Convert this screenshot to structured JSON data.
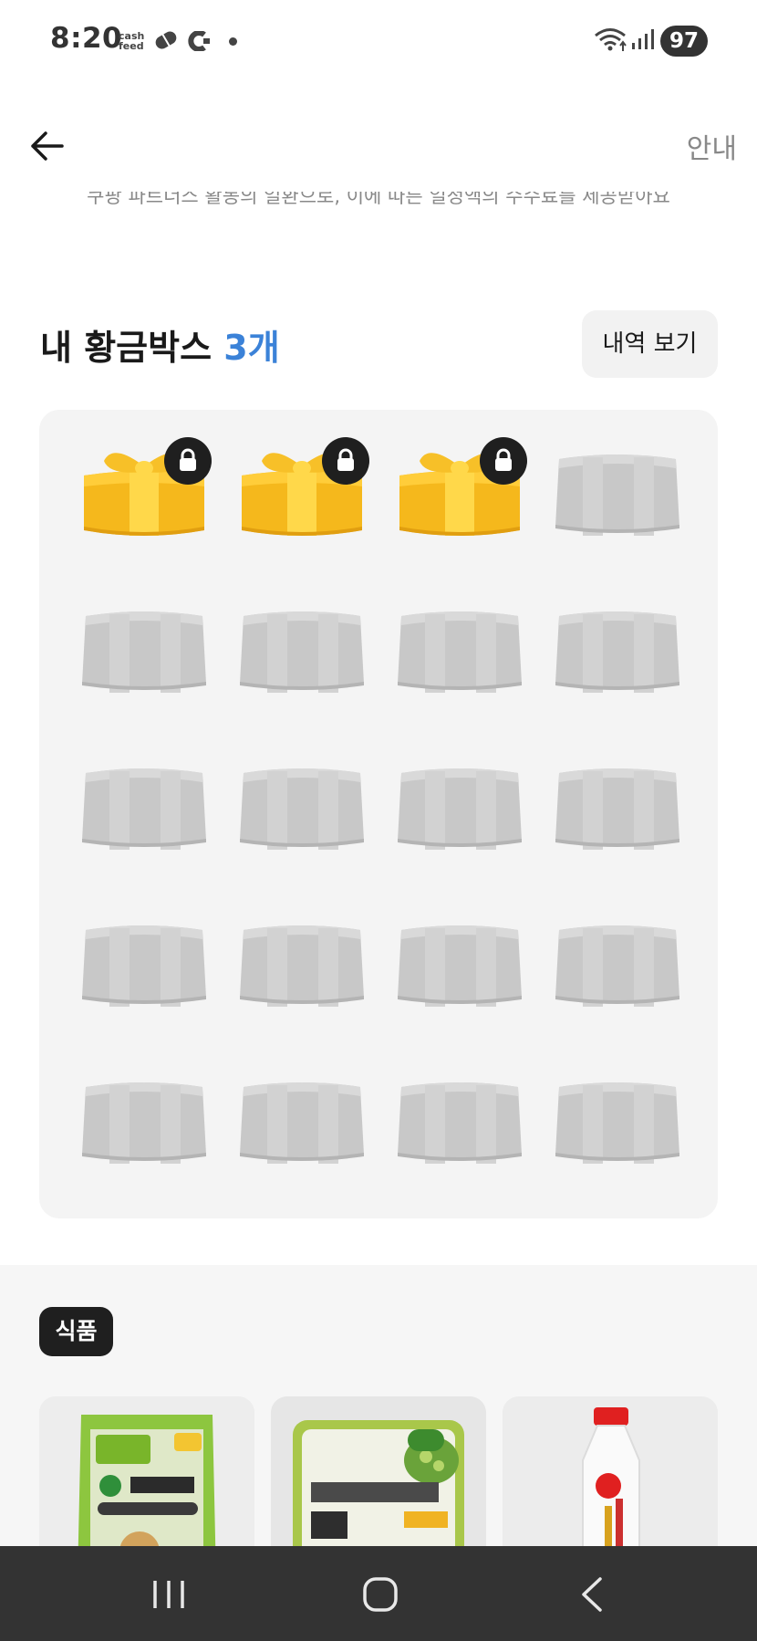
{
  "status_bar": {
    "time": "8:20",
    "app_badge": "cash feed",
    "battery": "97",
    "icons": [
      "cashfeed-icon",
      "pill-icon",
      "c-app-icon",
      "notification-dot-icon",
      "wifi-icon",
      "signal-icon",
      "battery-icon"
    ]
  },
  "header": {
    "back_icon": "arrow-left-icon",
    "guide_label": "안내",
    "partner_note": "쿠팡 파트너스 활동의 일환으로, 이에 따른 일정액의 수수료를 제공받아요"
  },
  "golden_boxes": {
    "title": "내 황금박스",
    "count_label": "3개",
    "history_button": "내역 보기",
    "total_slots": 20,
    "filled_slots": 3,
    "filled_icon": "gift-box-icon",
    "lock_icon": "lock-icon",
    "empty_icon": "empty-box-icon",
    "colors": {
      "gift": "#f5b81c",
      "ribbon": "#ffd84a",
      "empty": "#c8c8c8",
      "accent": "#3b82d8"
    }
  },
  "food": {
    "category_label": "식품",
    "products": [
      {
        "icon": "bean-sprout-package-icon"
      },
      {
        "icon": "tofu-package-icon"
      },
      {
        "icon": "milk-bottle-icon"
      }
    ]
  },
  "nav_bar": {
    "items": [
      "recent-apps-icon",
      "home-icon",
      "back-icon"
    ]
  }
}
